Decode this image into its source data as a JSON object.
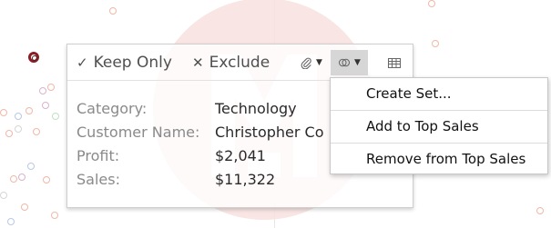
{
  "toolbar": {
    "keep_only": "Keep Only",
    "exclude": "Exclude",
    "keep_only_icon": "check-icon",
    "exclude_icon": "x-icon",
    "group_icon": "paperclip-icon",
    "sets_icon": "venn-icon",
    "view_data_icon": "table-icon"
  },
  "tooltip": {
    "fields": [
      {
        "label": "Category:",
        "value": "Technology"
      },
      {
        "label": "Customer Name:",
        "value": "Christopher Co"
      },
      {
        "label": "Profit:",
        "value": "$2,041"
      },
      {
        "label": "Sales:",
        "value": "$11,322"
      }
    ]
  },
  "menu": {
    "items": [
      "Create Set...",
      "Add to Top Sales",
      "Remove from Top Sales"
    ]
  },
  "colors": {
    "selected_mark": "#8f1b22",
    "watermark": "#e47d73",
    "active_button": "#d6d6d6"
  }
}
